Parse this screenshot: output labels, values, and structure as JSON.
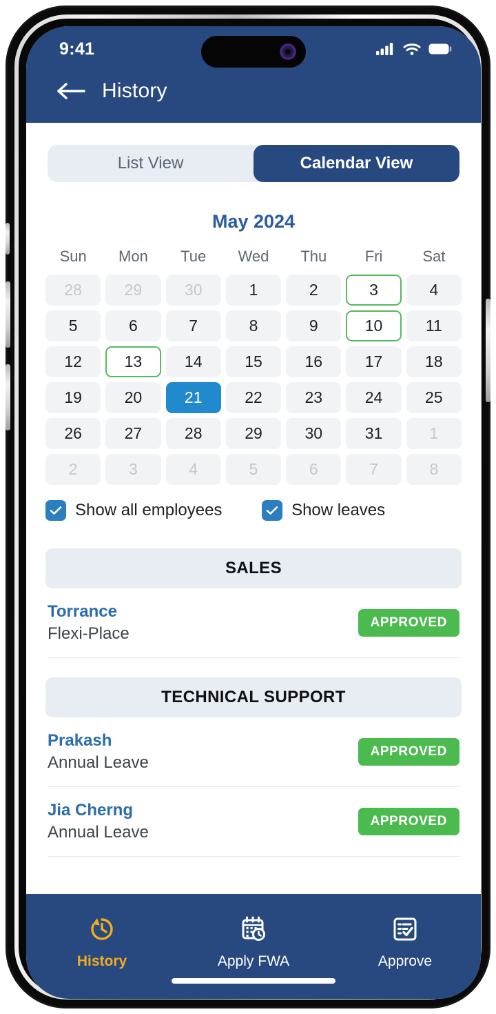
{
  "status_bar": {
    "time": "9:41",
    "icons": [
      "signal-icon",
      "wifi-icon",
      "battery-icon"
    ]
  },
  "header": {
    "back_icon": "back-arrow-icon",
    "title": "History"
  },
  "view_toggle": {
    "options": [
      {
        "label": "List View",
        "active": false
      },
      {
        "label": "Calendar View",
        "active": true
      }
    ]
  },
  "calendar": {
    "month_title": "May 2024",
    "weekdays": [
      "Sun",
      "Mon",
      "Tue",
      "Wed",
      "Thu",
      "Fri",
      "Sat"
    ],
    "selected_day": 21,
    "marked_days": [
      3,
      10,
      13
    ],
    "weeks": [
      [
        {
          "d": "28",
          "state": "muted"
        },
        {
          "d": "29",
          "state": "muted"
        },
        {
          "d": "30",
          "state": "muted"
        },
        {
          "d": "1",
          "state": "normal"
        },
        {
          "d": "2",
          "state": "normal"
        },
        {
          "d": "3",
          "state": "marked"
        },
        {
          "d": "4",
          "state": "normal"
        }
      ],
      [
        {
          "d": "5",
          "state": "normal"
        },
        {
          "d": "6",
          "state": "normal"
        },
        {
          "d": "7",
          "state": "normal"
        },
        {
          "d": "8",
          "state": "normal"
        },
        {
          "d": "9",
          "state": "normal"
        },
        {
          "d": "10",
          "state": "marked"
        },
        {
          "d": "11",
          "state": "normal"
        }
      ],
      [
        {
          "d": "12",
          "state": "normal"
        },
        {
          "d": "13",
          "state": "marked"
        },
        {
          "d": "14",
          "state": "normal"
        },
        {
          "d": "15",
          "state": "normal"
        },
        {
          "d": "16",
          "state": "normal"
        },
        {
          "d": "17",
          "state": "normal"
        },
        {
          "d": "18",
          "state": "normal"
        }
      ],
      [
        {
          "d": "19",
          "state": "normal"
        },
        {
          "d": "20",
          "state": "normal"
        },
        {
          "d": "21",
          "state": "selected"
        },
        {
          "d": "22",
          "state": "normal"
        },
        {
          "d": "23",
          "state": "normal"
        },
        {
          "d": "24",
          "state": "normal"
        },
        {
          "d": "25",
          "state": "normal"
        }
      ],
      [
        {
          "d": "26",
          "state": "normal"
        },
        {
          "d": "27",
          "state": "normal"
        },
        {
          "d": "28",
          "state": "normal"
        },
        {
          "d": "29",
          "state": "normal"
        },
        {
          "d": "30",
          "state": "normal"
        },
        {
          "d": "31",
          "state": "normal"
        },
        {
          "d": "1",
          "state": "muted"
        }
      ],
      [
        {
          "d": "2",
          "state": "muted"
        },
        {
          "d": "3",
          "state": "muted"
        },
        {
          "d": "4",
          "state": "muted"
        },
        {
          "d": "5",
          "state": "muted"
        },
        {
          "d": "6",
          "state": "muted"
        },
        {
          "d": "7",
          "state": "muted"
        },
        {
          "d": "8",
          "state": "muted"
        }
      ]
    ]
  },
  "filters": [
    {
      "label": "Show all employees",
      "checked": true
    },
    {
      "label": "Show leaves",
      "checked": true
    }
  ],
  "sections": [
    {
      "title": "SALES",
      "records": [
        {
          "name": "Torrance",
          "type": "Flexi-Place",
          "status": "APPROVED"
        }
      ]
    },
    {
      "title": "TECHNICAL SUPPORT",
      "records": [
        {
          "name": "Prakash",
          "type": "Annual Leave",
          "status": "APPROVED"
        },
        {
          "name": "Jia Cherng",
          "type": "Annual Leave",
          "status": "APPROVED"
        }
      ]
    }
  ],
  "bottom_nav": [
    {
      "label": "History",
      "icon": "history-clock-icon",
      "active": true
    },
    {
      "label": "Apply FWA",
      "icon": "calendar-clock-icon",
      "active": false
    },
    {
      "label": "Approve",
      "icon": "checklist-icon",
      "active": false
    }
  ],
  "colors": {
    "header_blue": "#28497f",
    "selected_day_blue": "#2189ce",
    "approved_green": "#4cbb4f",
    "marked_outline_green": "#57b85d",
    "active_nav_amber": "#f0ad1f",
    "month_title_blue": "#2b5b9e",
    "record_name_blue": "#2b6cad",
    "cell_gray": "#f1f3f5",
    "panel_gray": "#e8ecf3"
  }
}
